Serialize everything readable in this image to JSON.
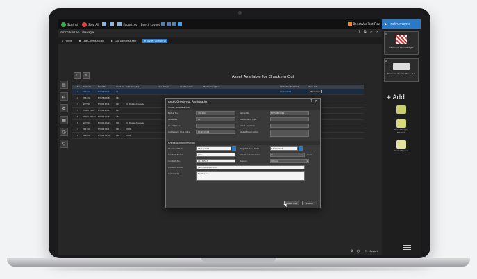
{
  "toolbar": {
    "items": [
      {
        "label": "Start All",
        "icon": "play-icon",
        "color": "#3fa34d"
      },
      {
        "label": "Stop All",
        "icon": "stop-icon",
        "color": "#d64541"
      },
      {
        "label": "",
        "icon": "chart-icon",
        "color": "#8fb3d9"
      },
      {
        "label": "",
        "icon": "folder-icon",
        "color": "#8fb3d9"
      },
      {
        "label": "Export .dc",
        "icon": "export-icon",
        "color": "#8fb3d9"
      },
      {
        "label": "Bench Layout",
        "icon": "layout-icon",
        "color": "#5a7da6"
      }
    ],
    "test_flow_label": "BenchVue Test Flow",
    "instruments_tab": "Instruments"
  },
  "app": {
    "title": "BenchVue Lab - Manager",
    "nav": [
      {
        "label": "Home",
        "icon": "home-icon"
      },
      {
        "label": "Lab Configuration",
        "icon": "config-icon"
      },
      {
        "label": "Lab Administrator",
        "icon": "admin-icon"
      },
      {
        "label": "Asset Checking",
        "icon": "checking-icon"
      }
    ],
    "active_nav": 3
  },
  "list": {
    "title": "Asset Available for Checking Out",
    "headers": [
      "",
      "No.",
      "Model No.",
      "Serial No.",
      "Asset No.",
      "Instrument Type",
      "Asset Owner",
      "Asset Location",
      "Model Description",
      "",
      "Calibration Due Date",
      "Check Out"
    ],
    "rows": [
      {
        "no": "1",
        "model": "33622A",
        "serial": "MY53801321",
        "asset": "11",
        "type": "",
        "owner": "",
        "cal": "17/10/2018",
        "action": "Check Out",
        "selected": true
      },
      {
        "no": "2",
        "model": "33622A",
        "serial": "MY53802985",
        "asset": "18",
        "type": "",
        "owner": "",
        "cal": "",
        "action": "",
        "selected": false
      },
      {
        "no": "3",
        "model": "N6705B",
        "serial": "MY00130714",
        "asset": "120",
        "type": "DC Power Analyzer",
        "owner": "",
        "cal": "",
        "action": "",
        "selected": false
      },
      {
        "no": "4",
        "model": "DSO-X 2000",
        "serial": "MY00127842",
        "asset": "120",
        "type": "",
        "owner": "",
        "cal": "",
        "action": "",
        "selected": false
      },
      {
        "no": "5",
        "model": "DSO-X 3004A",
        "serial": "MY00211234",
        "asset": "250",
        "type": "",
        "owner": "",
        "cal": "",
        "action": "",
        "selected": false
      },
      {
        "no": "6",
        "model": "N6705C",
        "serial": "MY00211226",
        "asset": "100",
        "type": "DC Power Analyzer",
        "owner": "",
        "cal": "",
        "action": "",
        "selected": false
      },
      {
        "no": "7",
        "model": "34470A",
        "serial": "MY00279217",
        "asset": "160",
        "type": "DMM",
        "owner": "",
        "cal": "",
        "action": "",
        "selected": false
      },
      {
        "no": "8",
        "model": "34465A",
        "serial": "MY00279368",
        "asset": "160",
        "type": "DMM",
        "owner": "",
        "cal": "",
        "action": "",
        "selected": false
      }
    ]
  },
  "dialog": {
    "title": "Asset Check-out Registration",
    "asset_section": "Asset Information",
    "asset_fields": {
      "model_label": "Model No.",
      "model_value": "33622A",
      "serial_label": "Serial No.",
      "serial_value": "MY53801321",
      "asset_label": "Asset No.",
      "asset_value": "11",
      "type_label": "Instrument Type",
      "type_value": "",
      "owner_label": "Asset Owner",
      "owner_value": "",
      "location_label": "Asset Location",
      "location_value": "",
      "cal_label": "Calibration Due Date",
      "cal_value": "17/10/2018",
      "desc_label": "Model Description",
      "desc_value": ""
    },
    "checkout_section": "Check-out Information",
    "checkout_fields": {
      "checkout_date_label": "Checkout Date",
      "checkout_date_value": "16/11/2018",
      "return_date_label": "Target Return Date",
      "return_date_value": "19/11/2018",
      "contact_name_label": "Contact Name",
      "contact_name_value": "John",
      "duration_label": "Check-out Duration",
      "duration_value": "3",
      "duration_unit": "days",
      "contact_no_label": "Contact No.",
      "contact_no_value": "01234567",
      "reason_label": "Reason",
      "reason_value": "Others",
      "email_label": "Contact Email",
      "email_value": "John@example.com",
      "comments_label": "Comments",
      "comments_value": "For Repair"
    },
    "checkout_button": "Check Out",
    "cancel_button": "Cancel"
  },
  "bottom": {
    "export_label": "Export"
  },
  "right_panel": {
    "card1_label": "BenchVue Lab Manager",
    "card1_badge": "1",
    "card2_label": "Precision Source/Meas. 1.0",
    "card2_badge": "2",
    "add_label": "Add",
    "items": [
      {
        "label": "Power Supply",
        "sub": "N6705C"
      },
      {
        "label": "Serial Device",
        "sub": ""
      }
    ]
  }
}
